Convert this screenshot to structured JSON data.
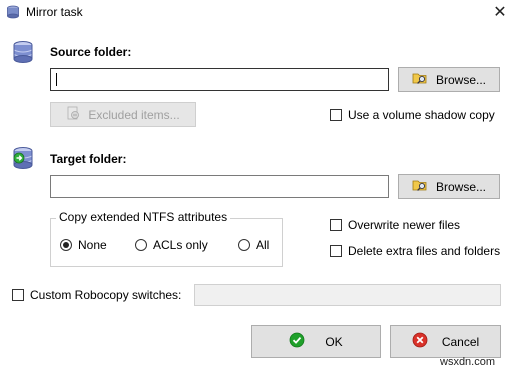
{
  "window": {
    "title": "Mirror task",
    "close_glyph": "✕"
  },
  "source": {
    "label": "Source folder:",
    "value": "",
    "browse_label": "Browse...",
    "excluded_label": "Excluded items...",
    "shadow_copy_label": "Use a volume shadow copy",
    "shadow_copy_checked": false
  },
  "target": {
    "label": "Target folder:",
    "value": "",
    "browse_label": "Browse..."
  },
  "ntfs": {
    "group_label": "Copy extended NTFS attributes",
    "options": [
      {
        "label": "None",
        "selected": true
      },
      {
        "label": "ACLs only",
        "selected": false
      },
      {
        "label": "All",
        "selected": false
      }
    ]
  },
  "options": {
    "overwrite_label": "Overwrite newer files",
    "overwrite_checked": false,
    "delete_label": "Delete extra files and folders",
    "delete_checked": false
  },
  "robocopy": {
    "label": "Custom Robocopy switches:",
    "checked": false,
    "value": ""
  },
  "footer": {
    "ok_label": "OK",
    "cancel_label": "Cancel",
    "watermark": "wsxdn.com"
  },
  "colors": {
    "ok_green": "#1fa02a",
    "cancel_red": "#d9322a",
    "db_blue": "#6a7fbf"
  }
}
